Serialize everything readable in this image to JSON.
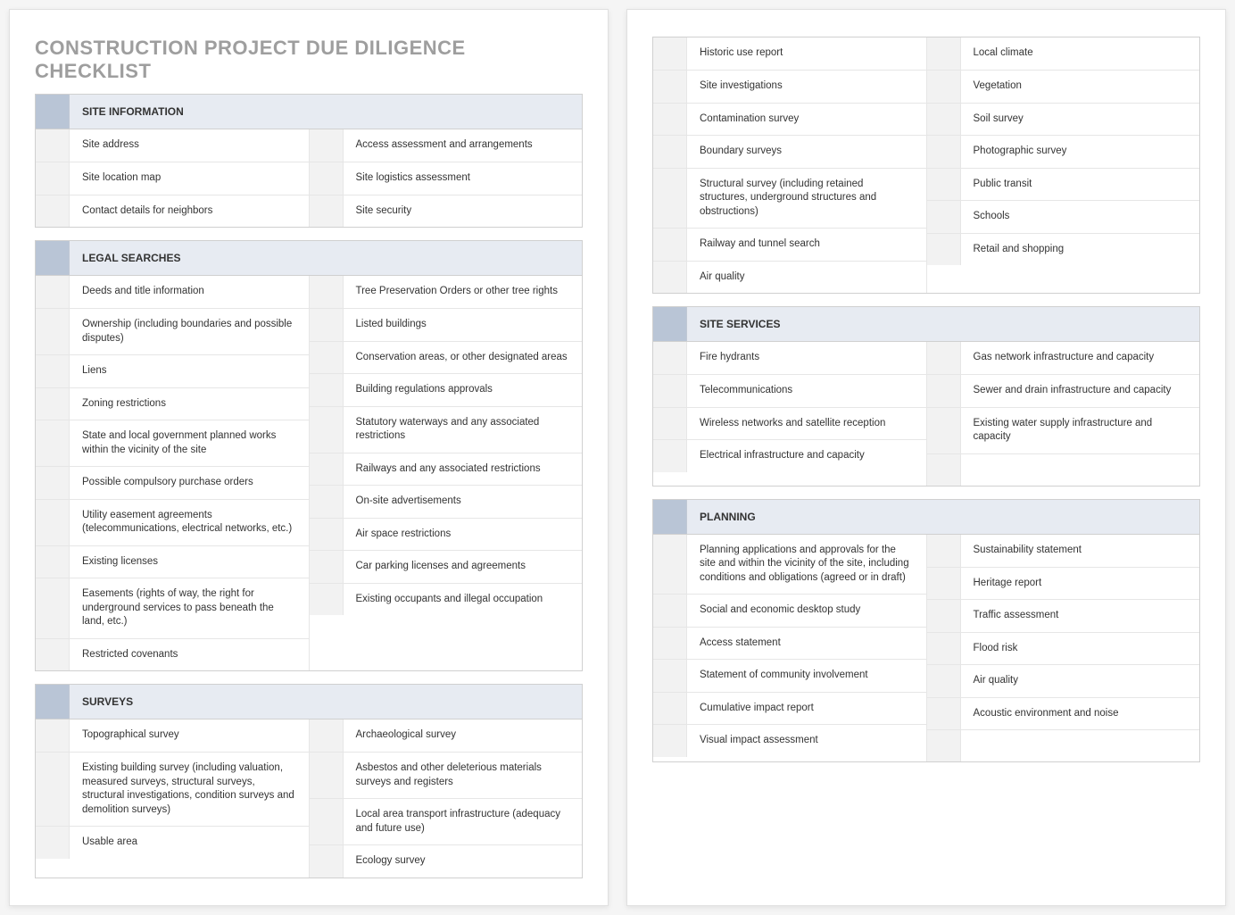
{
  "title": "CONSTRUCTION PROJECT DUE DILIGENCE CHECKLIST",
  "sections": [
    {
      "header": "SITE INFORMATION",
      "left": [
        "Site address",
        "Site location map",
        "Contact details for neighbors"
      ],
      "right": [
        "Access assessment and arrangements",
        "Site logistics assessment",
        "Site security"
      ]
    },
    {
      "header": "LEGAL SEARCHES",
      "left": [
        "Deeds and title information",
        "Ownership (including boundaries and possible disputes)",
        "Liens",
        "Zoning restrictions",
        "State and local government planned works within the vicinity of the site",
        "Possible compulsory purchase orders",
        "Utility easement agreements (telecommunications, electrical networks, etc.)",
        "Existing licenses",
        "Easements (rights of way, the right for underground services to pass beneath the land, etc.)",
        "Restricted covenants"
      ],
      "right": [
        "Tree Preservation Orders or other tree rights",
        "Listed buildings",
        "Conservation areas, or other designated areas",
        "Building regulations approvals",
        "Statutory waterways and any associated restrictions",
        "Railways and any associated restrictions",
        "On-site advertisements",
        "Air space restrictions",
        "Car parking licenses and agreements",
        "Existing occupants and illegal occupation"
      ]
    },
    {
      "header": "SURVEYS",
      "left": [
        "Topographical survey",
        "Existing building survey (including valuation, measured surveys, structural surveys, structural investigations, condition surveys and demolition surveys)",
        "Usable area"
      ],
      "right": [
        "Archaeological survey",
        "Asbestos and other deleterious materials surveys and registers",
        "Local area transport infrastructure (adequacy and future use)",
        "Ecology survey"
      ]
    },
    {
      "header": "",
      "left": [
        "Historic use report",
        "Site investigations",
        "Contamination survey",
        "Boundary surveys",
        "Structural survey (including retained structures, underground structures and obstructions)",
        "Railway and tunnel search",
        "Air quality"
      ],
      "right": [
        "Local climate",
        "Vegetation",
        "Soil survey",
        "Photographic survey",
        "Public transit",
        "Schools",
        "Retail and shopping"
      ]
    },
    {
      "header": "SITE SERVICES",
      "left": [
        "Fire hydrants",
        "Telecommunications",
        "Wireless networks and satellite reception",
        "Electrical infrastructure and capacity"
      ],
      "right": [
        "Gas network infrastructure and capacity",
        "Sewer and drain infrastructure and capacity",
        "Existing water supply infrastructure and capacity",
        ""
      ]
    },
    {
      "header": "PLANNING",
      "left": [
        "Planning applications and approvals for the site and within the vicinity of the site, including conditions and obligations (agreed or in draft)",
        "Social and economic desktop study",
        "Access statement",
        "Statement of community involvement",
        "Cumulative impact report",
        "Visual impact assessment"
      ],
      "right": [
        "Sustainability statement",
        "Heritage report",
        "Traffic assessment",
        "Flood risk",
        "Air quality",
        "Acoustic environment and noise",
        ""
      ]
    }
  ],
  "page1_sections": [
    0,
    1,
    2
  ],
  "page2_sections": [
    3,
    4,
    5
  ]
}
